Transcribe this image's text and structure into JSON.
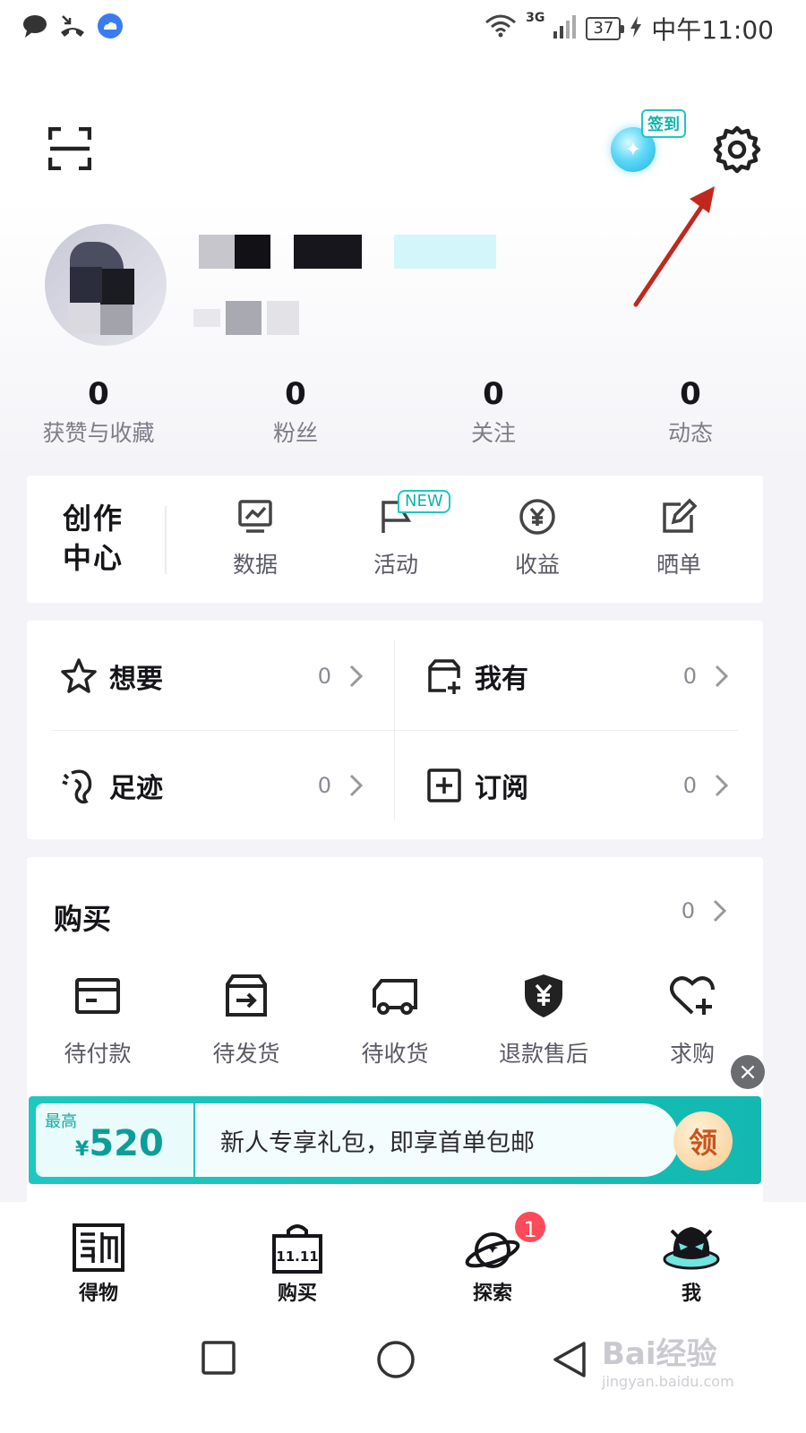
{
  "status_bar": {
    "network": "3G",
    "battery": "37",
    "time": "中午11:00",
    "icons": [
      "message-icon",
      "missed-call-icon",
      "cloud-icon",
      "wifi-icon",
      "signal-icon",
      "battery-icon",
      "charging-icon"
    ]
  },
  "header": {
    "scan_icon": "scan-icon",
    "checkin_label": "签到",
    "settings_icon": "gear-icon",
    "annotation_color": "#c0281e"
  },
  "stats": [
    {
      "value": "0",
      "label": "获赞与收藏"
    },
    {
      "value": "0",
      "label": "粉丝"
    },
    {
      "value": "0",
      "label": "关注"
    },
    {
      "value": "0",
      "label": "动态"
    }
  ],
  "creator_center": {
    "title": "创作\n中心",
    "items": [
      {
        "label": "数据",
        "icon": "chart-icon"
      },
      {
        "label": "活动",
        "icon": "flag-icon",
        "badge": "NEW"
      },
      {
        "label": "收益",
        "icon": "yen-icon"
      },
      {
        "label": "晒单",
        "icon": "edit-icon"
      }
    ]
  },
  "collections": [
    {
      "label": "想要",
      "count": "0",
      "icon": "star-icon"
    },
    {
      "label": "我有",
      "count": "0",
      "icon": "box-add-icon"
    },
    {
      "label": "足迹",
      "count": "0",
      "icon": "footprint-icon"
    },
    {
      "label": "订阅",
      "count": "0",
      "icon": "plus-square-icon"
    }
  ],
  "purchase": {
    "title": "购买",
    "count": "0",
    "items": [
      {
        "label": "待付款",
        "icon": "wallet-icon"
      },
      {
        "label": "待发货",
        "icon": "package-out-icon"
      },
      {
        "label": "待收货",
        "icon": "truck-icon"
      },
      {
        "label": "退款售后",
        "icon": "shield-yen-icon"
      },
      {
        "label": "求购",
        "icon": "heart-plus-icon"
      }
    ]
  },
  "promo": {
    "tag": "最高",
    "currency": "¥",
    "amount": "520",
    "text": "新人专享礼包，即享首单包邮",
    "button": "领",
    "accent": "#1ec8c0"
  },
  "tabbar": [
    {
      "label": "得物",
      "icon": "dewu-logo-icon"
    },
    {
      "label": "购买",
      "icon": "shopping-bag-icon",
      "bag_text": "11.11"
    },
    {
      "label": "探索",
      "icon": "planet-icon",
      "badge": "1"
    },
    {
      "label": "我",
      "icon": "avatar-mascot-icon"
    }
  ],
  "watermark": {
    "brand": "Bai经验",
    "url": "jingyan.baidu.com"
  }
}
